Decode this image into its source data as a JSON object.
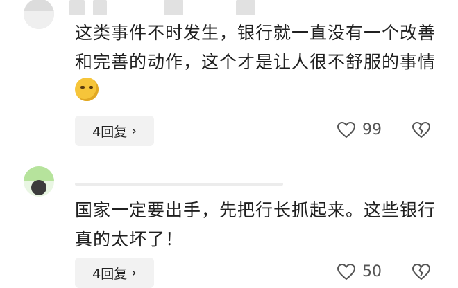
{
  "comments": [
    {
      "text": "这类事件不时发生，银行就一直没有一个改善和完善的动作，这个才是让人很不舒服的事情",
      "reply_label": "4回复",
      "chevron": "›",
      "likes": "99",
      "emoji": "thinking-face-emoji"
    },
    {
      "text": "国家一定要出手，先把行长抓起来。这些银行真的太坏了！",
      "reply_label": "4回复",
      "chevron": "›",
      "likes": "50"
    }
  ],
  "icons": {
    "like": "heart-outline-icon",
    "dislike": "broken-heart-icon"
  }
}
